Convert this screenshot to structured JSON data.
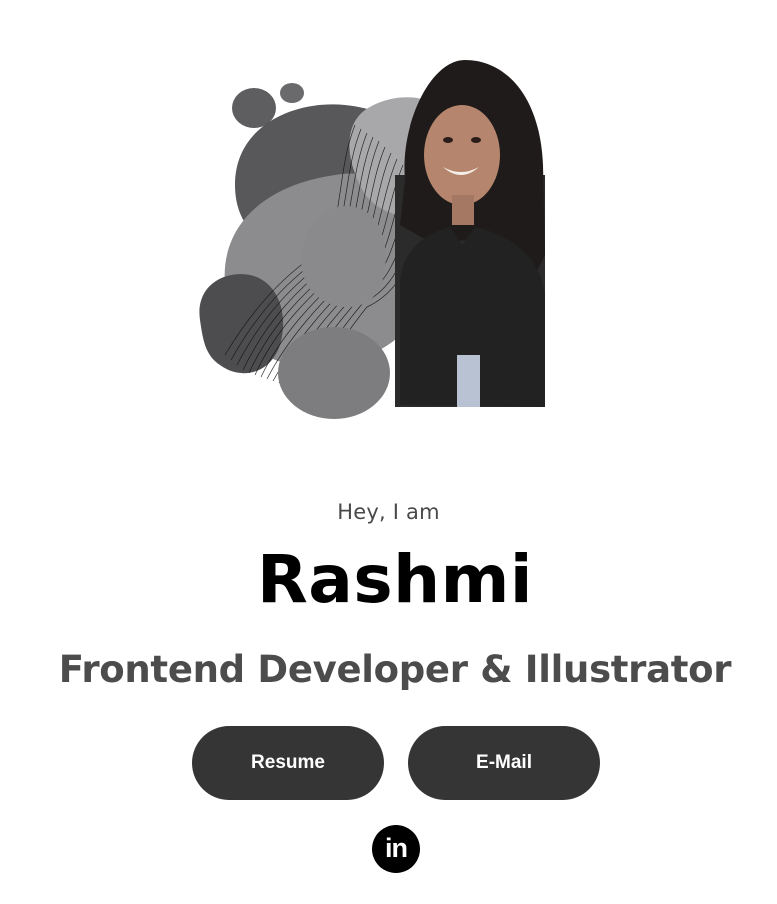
{
  "hero": {
    "greeting": "Hey, I am",
    "name": "Rashmi",
    "role": "Frontend Developer & Illustrator"
  },
  "actions": {
    "resume_label": "Resume",
    "email_label": "E-Mail"
  },
  "social": {
    "linkedin_icon": "linkedin-icon",
    "linkedin_glyph": "in"
  },
  "colors": {
    "button_bg": "#353535",
    "button_text": "#ffffff",
    "name_text": "#000000",
    "role_text": "#4c4c4c",
    "greeting_text": "#4a4a4a"
  }
}
